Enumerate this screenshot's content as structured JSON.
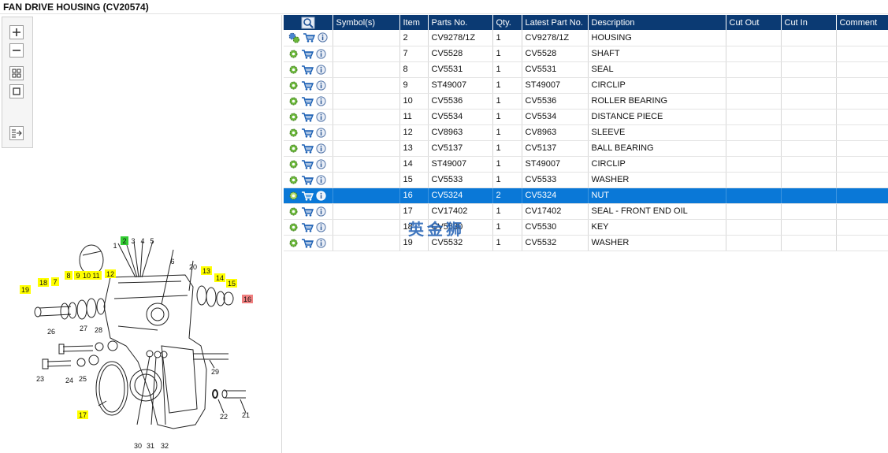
{
  "window": {
    "title": "FAN DRIVE HOUSING (CV20574)"
  },
  "toolbar": {
    "buttons": [
      {
        "name": "zoom-in",
        "icon": "plus-icon"
      },
      {
        "name": "zoom-out",
        "icon": "minus-icon"
      },
      {
        "name": "fit-all",
        "icon": "grid-icon"
      },
      {
        "name": "fit-window",
        "icon": "square-icon"
      },
      {
        "name": "export-list",
        "icon": "list-export-icon"
      }
    ]
  },
  "diagram": {
    "labels": [
      {
        "text": "1"
      },
      {
        "text": "2",
        "hl": "green"
      },
      {
        "text": "3"
      },
      {
        "text": "4"
      },
      {
        "text": "5"
      },
      {
        "text": "6"
      },
      {
        "text": "7",
        "hl": "yellow"
      },
      {
        "text": "8",
        "hl": "yellow"
      },
      {
        "text": "9",
        "hl": "yellow"
      },
      {
        "text": "10",
        "hl": "yellow"
      },
      {
        "text": "11",
        "hl": "yellow"
      },
      {
        "text": "12",
        "hl": "yellow"
      },
      {
        "text": "13",
        "hl": "yellow"
      },
      {
        "text": "14",
        "hl": "yellow"
      },
      {
        "text": "15",
        "hl": "yellow"
      },
      {
        "text": "16",
        "hl": "red"
      },
      {
        "text": "17",
        "hl": "yellow"
      },
      {
        "text": "18",
        "hl": "yellow"
      },
      {
        "text": "19",
        "hl": "yellow"
      },
      {
        "text": "20"
      },
      {
        "text": "21"
      },
      {
        "text": "22"
      },
      {
        "text": "23"
      },
      {
        "text": "24"
      },
      {
        "text": "25"
      },
      {
        "text": "26"
      },
      {
        "text": "27"
      },
      {
        "text": "28"
      },
      {
        "text": "29"
      },
      {
        "text": "30"
      },
      {
        "text": "31"
      },
      {
        "text": "32"
      }
    ],
    "colors": {
      "yellow": "#ffff00",
      "green": "#33cc33",
      "red": "#f08080"
    }
  },
  "table": {
    "columns": [
      "Symbol(s)",
      "Item",
      "Parts No.",
      "Qty.",
      "Latest Part No.",
      "Description",
      "Cut Out",
      "Cut In",
      "Comment"
    ],
    "header_icon": "magnifier-icon",
    "rows": [
      {
        "item": "2",
        "part": "CV9278/1Z",
        "qty": "1",
        "latest": "CV9278/1Z",
        "desc": "HOUSING",
        "gear": "double"
      },
      {
        "item": "7",
        "part": "CV5528",
        "qty": "1",
        "latest": "CV5528",
        "desc": "SHAFT"
      },
      {
        "item": "8",
        "part": "CV5531",
        "qty": "1",
        "latest": "CV5531",
        "desc": "SEAL"
      },
      {
        "item": "9",
        "part": "ST49007",
        "qty": "1",
        "latest": "ST49007",
        "desc": "CIRCLIP"
      },
      {
        "item": "10",
        "part": "CV5536",
        "qty": "1",
        "latest": "CV5536",
        "desc": "ROLLER BEARING"
      },
      {
        "item": "11",
        "part": "CV5534",
        "qty": "1",
        "latest": "CV5534",
        "desc": "DISTANCE PIECE"
      },
      {
        "item": "12",
        "part": "CV8963",
        "qty": "1",
        "latest": "CV8963",
        "desc": "SLEEVE"
      },
      {
        "item": "13",
        "part": "CV5137",
        "qty": "1",
        "latest": "CV5137",
        "desc": "BALL BEARING"
      },
      {
        "item": "14",
        "part": "ST49007",
        "qty": "1",
        "latest": "ST49007",
        "desc": "CIRCLIP"
      },
      {
        "item": "15",
        "part": "CV5533",
        "qty": "1",
        "latest": "CV5533",
        "desc": "WASHER"
      },
      {
        "item": "16",
        "part": "CV5324",
        "qty": "2",
        "latest": "CV5324",
        "desc": "NUT",
        "selected": true
      },
      {
        "item": "17",
        "part": "CV17402",
        "qty": "1",
        "latest": "CV17402",
        "desc": "SEAL - FRONT END OIL"
      },
      {
        "item": "18",
        "part": "CV5530",
        "qty": "1",
        "latest": "CV5530",
        "desc": "KEY"
      },
      {
        "item": "19",
        "part": "CV5532",
        "qty": "1",
        "latest": "CV5532",
        "desc": "WASHER"
      }
    ]
  },
  "watermark": {
    "text": "英金狮"
  }
}
